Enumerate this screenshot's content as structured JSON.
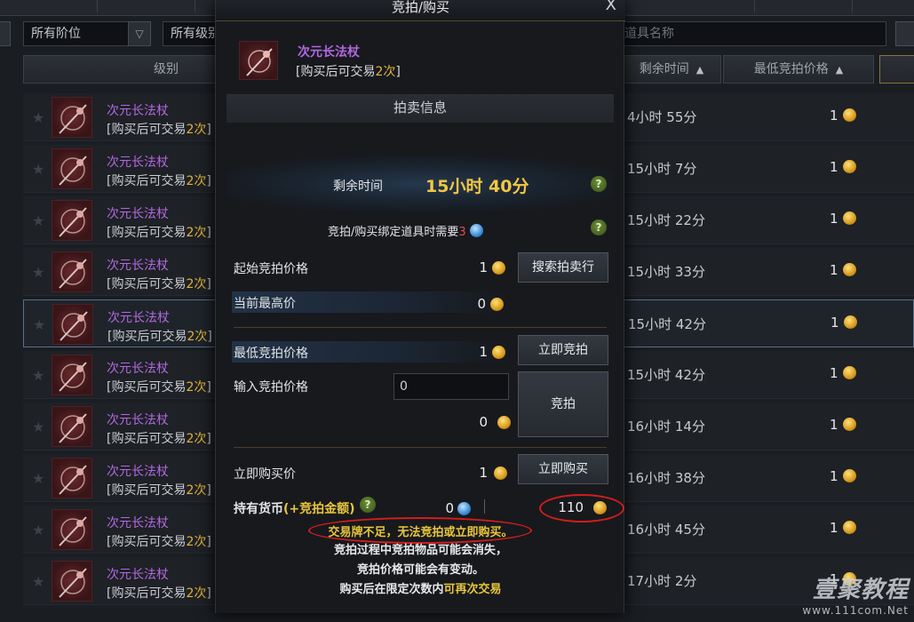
{
  "background": {
    "filters": {
      "tier": "所有阶位",
      "level": "所有级别",
      "search_placeholder": "输入道具名称"
    },
    "headers": {
      "level": "级别",
      "time_left": "剩余时间",
      "min_bid": "最低竞拍价格"
    },
    "rows": [
      {
        "name": "次元长法杖",
        "note_prefix": "[购买后可交易",
        "note_count": "2次",
        "note_suffix": "]",
        "time": "4小时 55分",
        "price": "1"
      },
      {
        "name": "次元长法杖",
        "note_prefix": "[购买后可交易",
        "note_count": "2次",
        "note_suffix": "]",
        "time": "15小时 7分",
        "price": "1"
      },
      {
        "name": "次元长法杖",
        "note_prefix": "[购买后可交易",
        "note_count": "2次",
        "note_suffix": "]",
        "time": "15小时 22分",
        "price": "1"
      },
      {
        "name": "次元长法杖",
        "note_prefix": "[购买后可交易",
        "note_count": "2次",
        "note_suffix": "]",
        "time": "15小时 33分",
        "price": "1"
      },
      {
        "name": "次元长法杖",
        "note_prefix": "[购买后可交易",
        "note_count": "2次",
        "note_suffix": "]",
        "time": "15小时 42分",
        "price": "1"
      },
      {
        "name": "次元长法杖",
        "note_prefix": "[购买后可交易",
        "note_count": "2次",
        "note_suffix": "]",
        "time": "15小时 42分",
        "price": "1"
      },
      {
        "name": "次元长法杖",
        "note_prefix": "[购买后可交易",
        "note_count": "2次",
        "note_suffix": "]",
        "time": "16小时 14分",
        "price": "1"
      },
      {
        "name": "次元长法杖",
        "note_prefix": "[购买后可交易",
        "note_count": "2次",
        "note_suffix": "]",
        "time": "16小时 38分",
        "price": "1"
      },
      {
        "name": "次元长法杖",
        "note_prefix": "[购买后可交易",
        "note_count": "2次",
        "note_suffix": "]",
        "time": "16小时 45分",
        "price": "1"
      },
      {
        "name": "次元长法杖",
        "note_prefix": "[购买后可交易",
        "note_count": "2次",
        "note_suffix": "]",
        "time": "17小时 2分",
        "price": "1"
      }
    ],
    "selected_row": 4
  },
  "modal": {
    "title": "竞拍/购买",
    "close": "X",
    "item": {
      "name": "次元长法杖",
      "note_prefix": "[购买后可交易",
      "note_count": "2次",
      "note_suffix": "]"
    },
    "section_title": "拍卖信息",
    "time_left_label": "剩余时间",
    "time_left_value": "15小时 40分",
    "bind_label": "竞拍/购买绑定道具时需要",
    "bind_count": "3",
    "start_price_label": "起始竞拍价格",
    "start_price": "1",
    "search_button": "搜索拍卖行",
    "current_high_label": "当前最高价",
    "current_high": "0",
    "min_bid_label": "最低竞拍价格",
    "min_bid": "1",
    "instant_bid_button": "立即竞拍",
    "enter_bid_label": "输入竞拍价格",
    "bid_input_value": "0",
    "bid_total": "0",
    "bid_button": "竞拍",
    "buyout_label": "立即购买价",
    "buyout_price": "1",
    "buyout_button": "立即购买",
    "currency_label": "持有货币",
    "currency_bonus": "(+竞拍金额)",
    "currency_gems": "0",
    "currency_coins": "110",
    "warning": "交易牌不足，无法竞拍或立即购买。",
    "notes": [
      "竞拍过程中竞拍物品可能会消失，",
      "竞拍价格可能会有变动。"
    ],
    "note_last_prefix": "购买后在限定次数内",
    "note_last_highlight": "可再次交易"
  },
  "watermark": {
    "brand": "壹聚教程",
    "url": "www.111com.Net"
  },
  "colors": {
    "purple_item": "#b169e0",
    "gold": "#e0b43a",
    "time_yellow": "#f2c744",
    "warning_yellow": "#e8c63c",
    "ring_red": "#d21d1d"
  }
}
